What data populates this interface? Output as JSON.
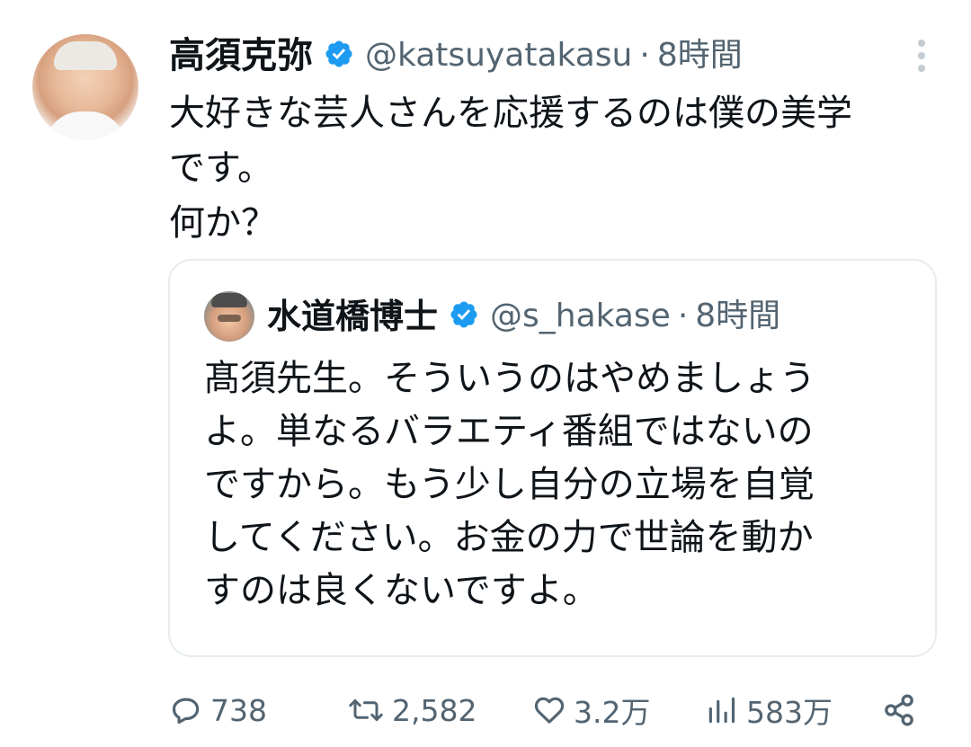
{
  "tweet": {
    "author_name": "高須克弥",
    "author_handle": "@katsuyatakasu",
    "separator": "·",
    "time": "8時間",
    "text": "大好きな芸人さんを応援するのは僕の美学\nです。\n何か？"
  },
  "quote": {
    "author_name": "水道橋博士",
    "author_handle": "@s_hakase",
    "separator": "·",
    "time": "8時間",
    "text": "髙須先生。そういうのはやめましょう\nよ。単なるバラエティ番組ではないの\nですから。もう少し自分の立場を自覚\nしてください。お金の力で世論を動か\nすのは良くないですよ。"
  },
  "actions": {
    "reply_count": "738",
    "retweet_count": "2,582",
    "like_count": "3.2万",
    "view_count": "583万"
  },
  "icons": {
    "verified": "verified-badge-icon",
    "more": "more-vertical-icon",
    "reply": "reply-icon",
    "retweet": "retweet-icon",
    "like": "heart-icon",
    "views": "analytics-icon",
    "share": "share-icon"
  },
  "colors": {
    "text": "#0f1419",
    "secondary": "#536471",
    "verified": "#1d9bf0",
    "border": "#e6ecf0"
  }
}
